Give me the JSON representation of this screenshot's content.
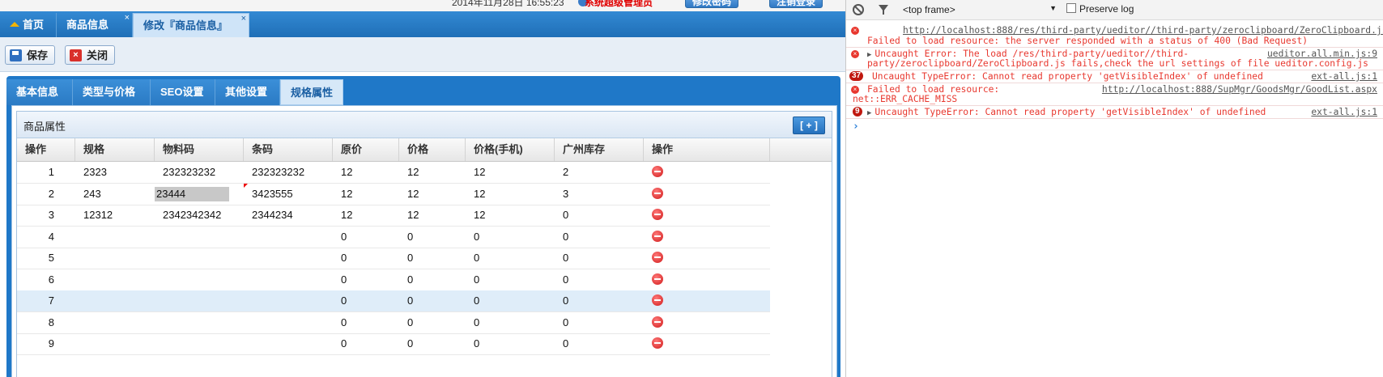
{
  "topbar": {
    "datetime": "2014年11月28日 16:55:23",
    "user": "系统超级管理员",
    "edit_password": "修改密码",
    "logout": "注销登录"
  },
  "tabs": [
    {
      "label": "首页",
      "icon": "home-icon"
    },
    {
      "label": "商品信息",
      "close": "×"
    },
    {
      "label": "修改『商品信息』",
      "close": "×",
      "active": true
    }
  ],
  "toolbar": {
    "save_label": "保存",
    "close_label": "关闭"
  },
  "subtabs": [
    "基本信息",
    "类型与价格",
    "SEO设置",
    "其他设置",
    "规格属性"
  ],
  "grid": {
    "title": "商品属性",
    "add_label": "[ + ]",
    "headers": [
      "操作",
      "规格",
      "物料码",
      "条码",
      "原价",
      "价格",
      "价格(手机)",
      "广州库存",
      "操作"
    ],
    "rows": [
      [
        "1",
        "2323",
        "232323232",
        "232323232",
        "12",
        "12",
        "12",
        "2"
      ],
      [
        "2",
        "243",
        "23444",
        "3423555",
        "12",
        "12",
        "12",
        "3"
      ],
      [
        "3",
        "12312",
        "2342342342",
        "2344234",
        "12",
        "12",
        "12",
        "0"
      ],
      [
        "4",
        "",
        "",
        "",
        "0",
        "0",
        "0",
        "0"
      ],
      [
        "5",
        "",
        "",
        "",
        "0",
        "0",
        "0",
        "0"
      ],
      [
        "6",
        "",
        "",
        "",
        "0",
        "0",
        "0",
        "0"
      ],
      [
        "7",
        "",
        "",
        "",
        "0",
        "0",
        "0",
        "0"
      ],
      [
        "8",
        "",
        "",
        "",
        "0",
        "0",
        "0",
        "0"
      ],
      [
        "9",
        "",
        "",
        "",
        "0",
        "0",
        "0",
        "0"
      ]
    ],
    "delete_icon": "minus-circle-icon",
    "selected_row": 7
  },
  "devtools": {
    "frame": "<top frame>",
    "preserve_log": "Preserve log",
    "messages": [
      {
        "url": "http://localhost:888/res/third-party/ueditor//third-party/zeroclipboard/ZeroClipboard.js",
        "text": "Failed to load resource: the server responded with a status of 400 (Bad Request)"
      },
      {
        "text": "Uncaught Error: The load /res/third-party/ueditor//third-",
        "text2": "party/zeroclipboard/ZeroClipboard.js fails,check the url settings of file ueditor.config.js",
        "source": "ueditor.all.min.js:9"
      },
      {
        "count": "37",
        "text": "Uncaught TypeError: Cannot read property 'getVisibleIndex' of undefined",
        "source": "ext-all.js:1"
      },
      {
        "text": "Failed to load resource:",
        "url": "http://localhost:888/SupMgr/GoodsMgr/GoodList.aspx",
        "text2": "net::ERR_CACHE_MISS"
      },
      {
        "count": "9",
        "text": "Uncaught TypeError: Cannot read property 'getVisibleIndex' of undefined",
        "source": "ext-all.js:1"
      }
    ],
    "prompt": "›"
  },
  "colors": {
    "accent": "#1f78c8",
    "error": "#e8382f",
    "selected_row": "#dfedf9"
  }
}
